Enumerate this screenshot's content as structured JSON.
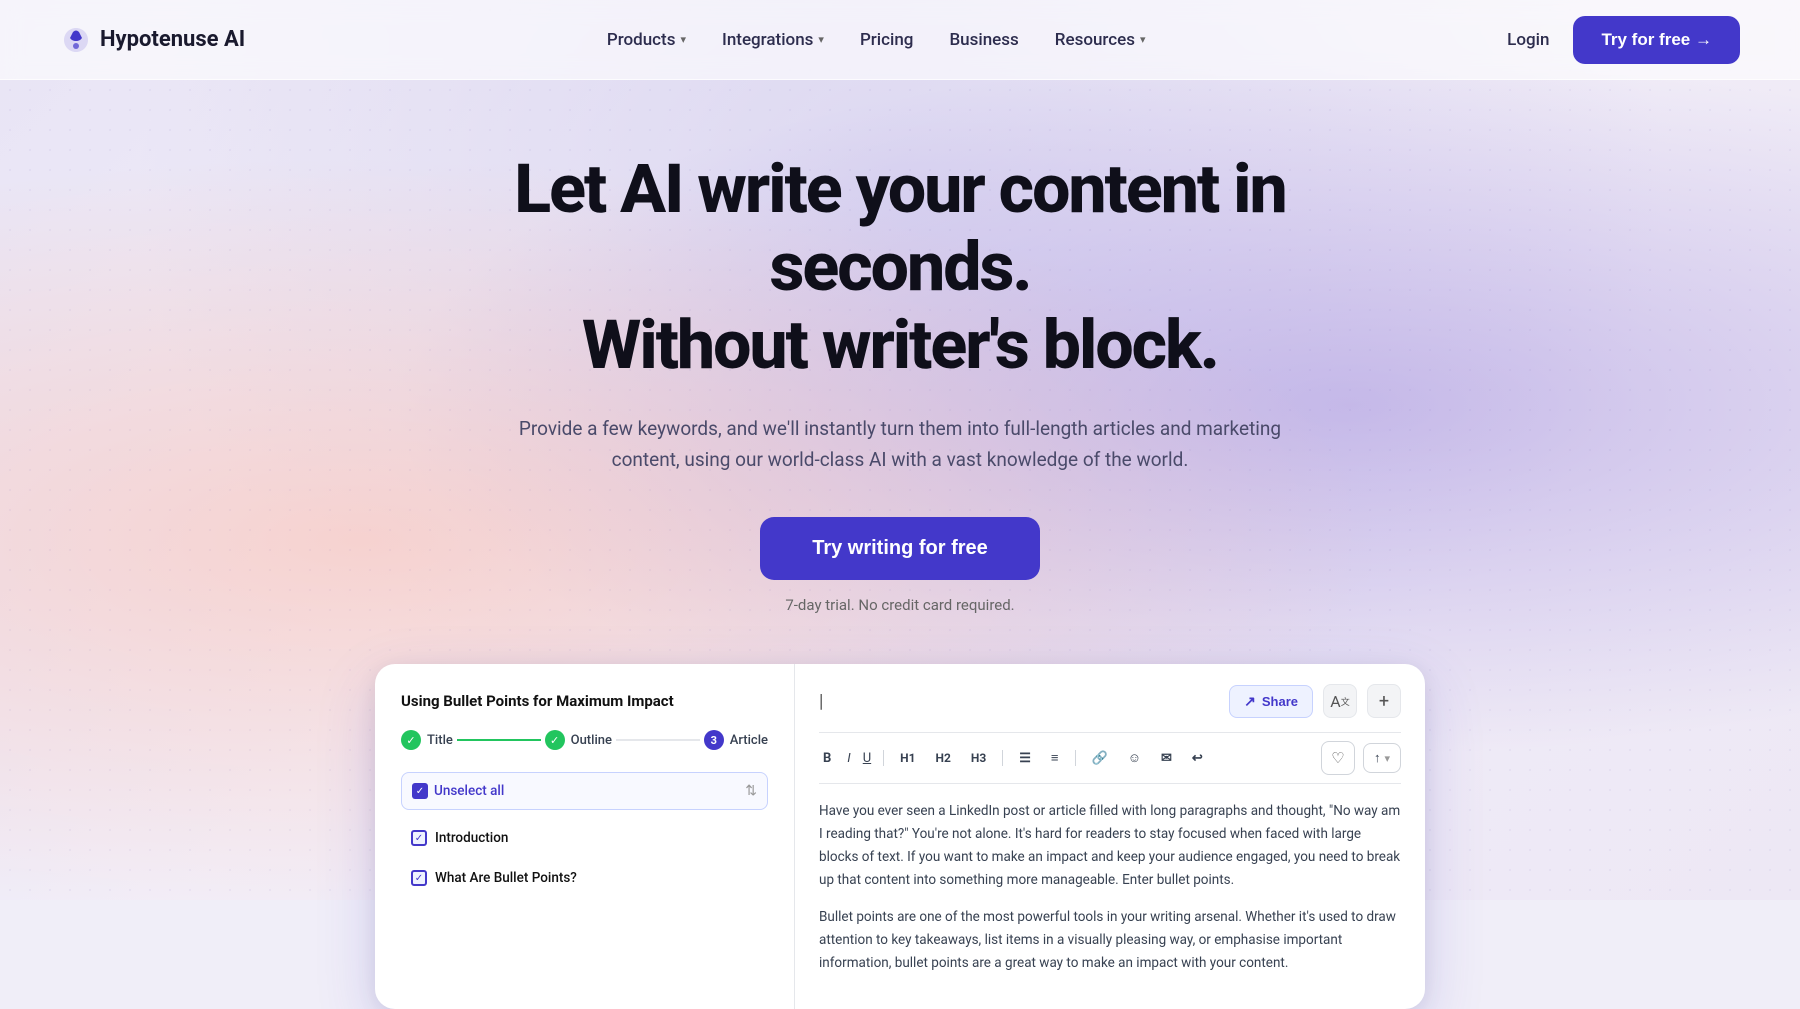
{
  "brand": {
    "name": "Hypotenuse AI",
    "logo_alt": "Hypotenuse AI logo"
  },
  "nav": {
    "links": [
      {
        "label": "Products",
        "has_dropdown": true
      },
      {
        "label": "Integrations",
        "has_dropdown": true
      },
      {
        "label": "Pricing",
        "has_dropdown": false
      },
      {
        "label": "Business",
        "has_dropdown": false
      },
      {
        "label": "Resources",
        "has_dropdown": true
      }
    ],
    "login_label": "Login",
    "try_free_label": "Try for free →"
  },
  "hero": {
    "title_line1": "Let AI write your content in seconds.",
    "title_line2": "Without writer's block.",
    "subtitle": "Provide a few keywords, and we'll instantly turn them into full-length articles and marketing content, using our world-class AI with a vast knowledge of the world.",
    "cta_label": "Try writing for free",
    "trial_note": "7-day trial. No credit card required."
  },
  "demo": {
    "left": {
      "topic": "Using Bullet Points for Maximum Impact",
      "steps": [
        {
          "label": "Title",
          "done": true
        },
        {
          "label": "Outline",
          "done": true
        },
        {
          "label": "Article",
          "done": false,
          "num": "3"
        }
      ],
      "unselect_label": "Unselect all",
      "items": [
        {
          "label": "Introduction",
          "checked": true
        },
        {
          "label": "What Are Bullet Points?",
          "checked": true
        }
      ]
    },
    "right": {
      "toolbar_items": [
        "B",
        "I",
        "U",
        "H1",
        "H2",
        "H3",
        "≡",
        "≡",
        "🔗",
        "😊",
        "✉",
        "↩"
      ],
      "share_label": "Share",
      "paragraph1": "Have you ever seen a LinkedIn post or article filled with long paragraphs and thought, \"No way am I reading that?\" You're not alone. It's hard for readers to stay focused when faced with large blocks of text. If you want to make an impact and keep your audience engaged, you need to break up that content into something more manageable. Enter bullet points.",
      "paragraph2": "Bullet points are one of the most powerful tools in your writing arsenal. Whether it's used to draw attention to key takeaways, list items in a visually pleasing way, or emphasise important information, bullet points are a great way to make an impact with your content."
    }
  }
}
